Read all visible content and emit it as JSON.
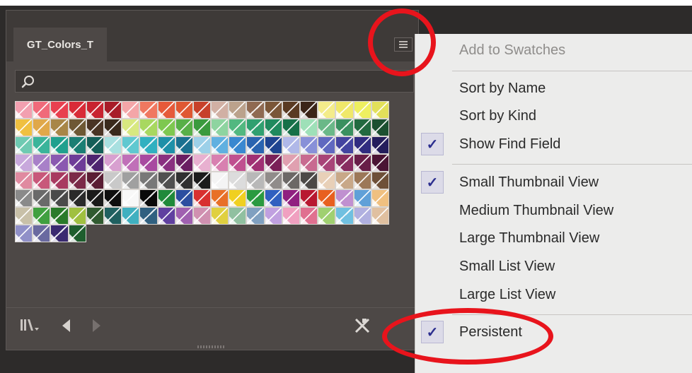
{
  "panel": {
    "tab_label": "GT_Colors_T",
    "menu_icon": "hamburger-menu-icon",
    "search_icon": "search-icon",
    "footer_icons": [
      "swatch-libraries-icon",
      "previous-library-icon",
      "next-library-icon",
      "delete-swatch-icon"
    ]
  },
  "swatches": [
    "#f2a0b0",
    "#f06a7a",
    "#e84050",
    "#d92b38",
    "#c82330",
    "#a81c28",
    "#f4a6a8",
    "#f07860",
    "#e65a3a",
    "#df5832",
    "#c7412a",
    "#d1b0a4",
    "#bba28c",
    "#8f6a52",
    "#7a5638",
    "#5a3a22",
    "#3b2418",
    "#f4ec8a",
    "#f0e86a",
    "#eef060",
    "#e2e05a",
    "#f0c040",
    "#e0a84a",
    "#a88648",
    "#6e5834",
    "#4a3424",
    "#3a2a1c",
    "#d8e880",
    "#a8d860",
    "#7ec850",
    "#58b048",
    "#3a9a3e",
    "#8ed4a0",
    "#52b880",
    "#30a070",
    "#208a5e",
    "#177048",
    "#9ee0b8",
    "#6ab888",
    "#3a9060",
    "#226a40",
    "#1c5030",
    "#6ecab2",
    "#3ab49a",
    "#20a08e",
    "#1a7e74",
    "#145e58",
    "#a8e0e0",
    "#60c8d0",
    "#30b0c0",
    "#1e90a8",
    "#1a7090",
    "#9cd0e8",
    "#60b0e0",
    "#3a88d0",
    "#2a64b0",
    "#1e4490",
    "#b0b8e8",
    "#8890d8",
    "#6068c0",
    "#4444a0",
    "#302c80",
    "#241e5c",
    "#c8a8dc",
    "#a880c8",
    "#8a58b0",
    "#6e3c98",
    "#4e2470",
    "#d8a0d0",
    "#c070b8",
    "#a84aa0",
    "#8a3080",
    "#6a1e62",
    "#e8b0d0",
    "#d880b0",
    "#c05090",
    "#a03074",
    "#7a2058",
    "#e0a0b0",
    "#c86a90",
    "#a84478",
    "#882c60",
    "#681e48",
    "#4a1434",
    "#e08aa0",
    "#c8587a",
    "#a83a60",
    "#7c2a48",
    "#5a1e34",
    "#c9c9c9",
    "#a0a0a0",
    "#787878",
    "#505050",
    "#303030",
    "#1c1c1c",
    "#f4f4f4",
    "#dcdcdc",
    "#b8b8b8",
    "#908c8a",
    "#6c6866",
    "#4c4846",
    "#e8d0b8",
    "#c8a888",
    "#9c7858",
    "#6e5038",
    "#8a8a8a",
    "#6a6a6a",
    "#4a4a4a",
    "#2a2a2a",
    "#1a1a1a",
    "#0e0e0e",
    "#f8f8f8",
    "#0a0a0a",
    "#1f8a3a",
    "#2c4ea0",
    "#d83030",
    "#e87028",
    "#f0d020",
    "#2a9a40",
    "#3060c0",
    "#902080",
    "#b81830",
    "#e86020",
    "#c090d0",
    "#60a0d8",
    "#f0c080",
    "#c8c0a8",
    "#40a040",
    "#2a7a2a",
    "#a0c040",
    "#305a30",
    "#206060",
    "#40b0c0",
    "#306080",
    "#6040a0",
    "#a060b0",
    "#d090b0",
    "#e0d040",
    "#90c0a0",
    "#80a0c0",
    "#c0a0e0",
    "#f0a0c0",
    "#e07090",
    "#a0d070",
    "#70c0e0",
    "#b0b0e0",
    "#e0c0a0",
    "#9090c8",
    "#6a6aa0",
    "#3a2a70",
    "#1e5e2e"
  ],
  "menu": {
    "items": [
      {
        "label": "Add to Swatches",
        "enabled": false,
        "checked": false
      },
      {
        "label": "Sort by Name",
        "enabled": true,
        "checked": false
      },
      {
        "label": "Sort by Kind",
        "enabled": true,
        "checked": false
      },
      {
        "label": "Show Find Field",
        "enabled": true,
        "checked": true
      },
      {
        "label": "Small Thumbnail View",
        "enabled": true,
        "checked": true
      },
      {
        "label": "Medium Thumbnail View",
        "enabled": true,
        "checked": false
      },
      {
        "label": "Large Thumbnail View",
        "enabled": true,
        "checked": false
      },
      {
        "label": "Small List View",
        "enabled": true,
        "checked": false
      },
      {
        "label": "Large List View",
        "enabled": true,
        "checked": false
      },
      {
        "label": "Persistent",
        "enabled": true,
        "checked": true
      }
    ],
    "check_glyph": "✓"
  },
  "colors": {
    "annotation": "#e8141c",
    "check": "#2c2f8f"
  }
}
